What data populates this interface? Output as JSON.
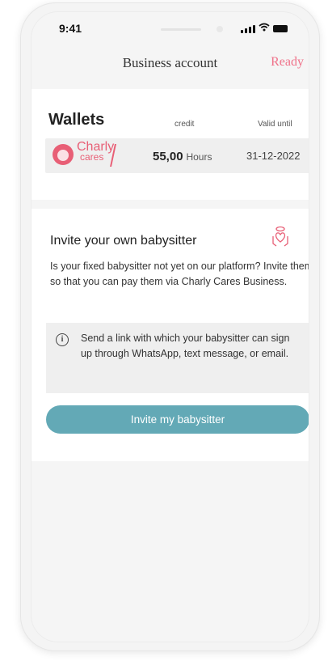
{
  "status_bar": {
    "time": "9:41"
  },
  "nav": {
    "title": "Business account",
    "ready_label": "Ready"
  },
  "wallets": {
    "title": "Wallets",
    "credit_header": "credit",
    "valid_header": "Valid until",
    "rows": [
      {
        "brand_line1": "Charly",
        "brand_line2": "cares",
        "credit_value": "55,00",
        "credit_unit": "Hours",
        "valid_until": "31-12-2022"
      }
    ]
  },
  "invite": {
    "title": "Invite your own babysitter",
    "description": "Is your fixed babysitter not yet on our platform? Invite them, so that you can pay them via Charly Cares Business.",
    "info_text": "Send a link with which your babysitter can sign up through WhatsApp, text message, or email.",
    "button_label": "Invite my babysitter"
  },
  "icons": {
    "info": "info-icon",
    "heart": "heart-hands-icon",
    "logo": "charly-cares-logo"
  },
  "colors": {
    "accent_pink": "#f0728a",
    "brand_pink": "#e85f76",
    "button_teal": "#63a9b6"
  }
}
